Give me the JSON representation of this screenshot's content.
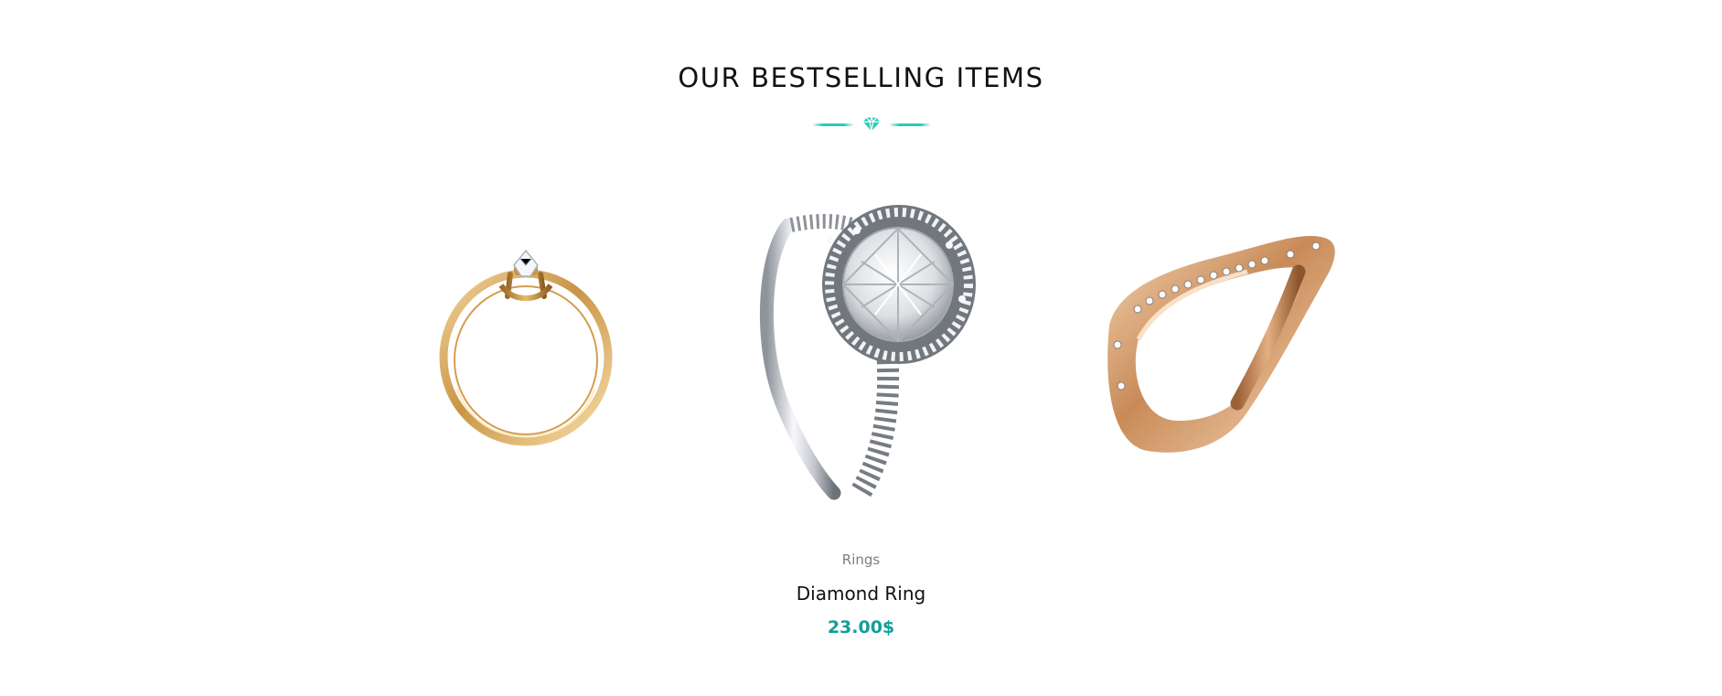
{
  "section": {
    "title": "OUR BESTSELLING ITEMS",
    "divider_icon": "diamond-icon",
    "accent_color": "#2acbb8",
    "price_color": "#119e97"
  },
  "products": [
    {
      "image": "gold-solitaire-ring-image"
    },
    {
      "image": "silver-halo-diamond-ring-image",
      "category": "Rings",
      "name": "Diamond Ring",
      "price": "23.00$"
    },
    {
      "image": "rose-gold-curved-diamond-band-image"
    }
  ]
}
